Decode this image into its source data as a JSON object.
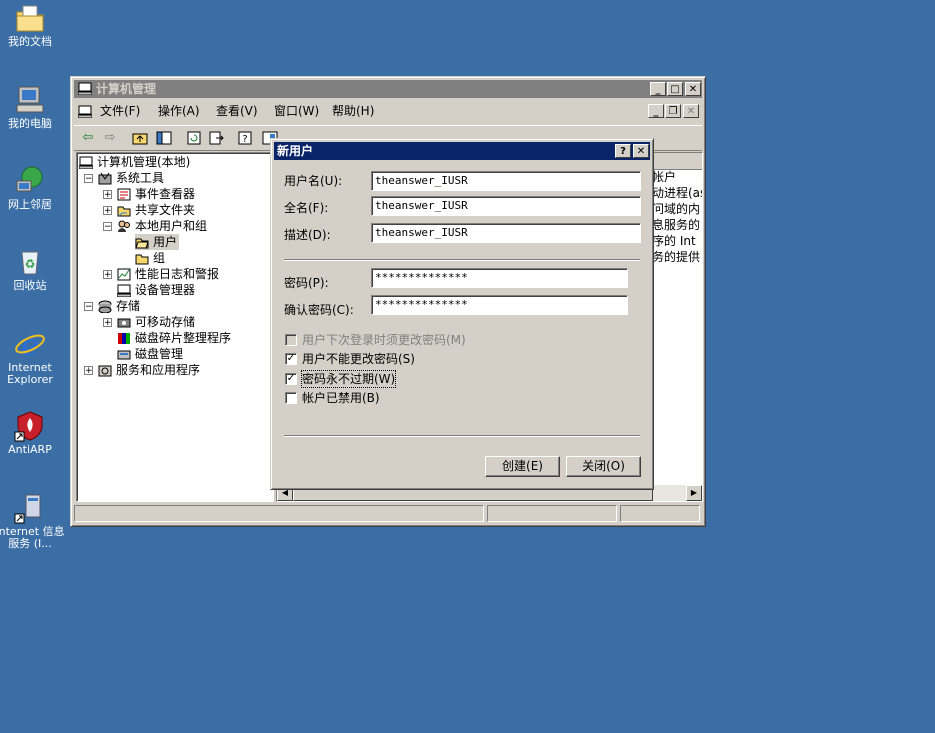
{
  "desktop": {
    "icons": [
      {
        "label": "我的文档",
        "icon": "my-documents-icon"
      },
      {
        "label": "我的电脑",
        "icon": "my-computer-icon"
      },
      {
        "label": "网上邻居",
        "icon": "network-places-icon"
      },
      {
        "label": "回收站",
        "icon": "recycle-bin-icon"
      },
      {
        "label": "Internet Explorer",
        "icon": "internet-explorer-icon"
      },
      {
        "label": "AntiARP",
        "icon": "antiarp-icon"
      },
      {
        "label": "Internet 信息服务 (I...",
        "icon": "iis-icon"
      }
    ]
  },
  "mmc": {
    "title": "计算机管理",
    "menu": [
      "文件(F)",
      "操作(A)",
      "查看(V)",
      "窗口(W)",
      "帮助(H)"
    ],
    "tree": {
      "root": "计算机管理(本地)",
      "system_tools": "系统工具",
      "event_viewer": "事件查看器",
      "shared_folders": "共享文件夹",
      "local_users_groups": "本地用户和组",
      "users": "用户",
      "groups": "组",
      "perf_logs": "性能日志和警报",
      "device_manager": "设备管理器",
      "storage": "存储",
      "removable_storage": "可移动存储",
      "defrag": "磁盘碎片整理程序",
      "disk_mgmt": "磁盘管理",
      "services_apps": "服务和应用程序"
    },
    "right_text": [
      "帐户",
      "动进程(as",
      "问域的内",
      "息服务的",
      "序的 Int",
      "务的提供"
    ]
  },
  "dialog": {
    "title": "新用户",
    "username_label": "用户名(U):",
    "username_value": "theanswer_IUSR",
    "fullname_label": "全名(F):",
    "fullname_value": "theanswer_IUSR",
    "desc_label": "描述(D):",
    "desc_value": "theanswer_IUSR",
    "password_label": "密码(P):",
    "password_value": "**************",
    "confirm_label": "确认密码(C):",
    "confirm_value": "**************",
    "opt_must_change": "用户下次登录时须更改密码(M)",
    "opt_cannot_change": "用户不能更改密码(S)",
    "opt_never_expires": "密码永不过期(W)",
    "opt_disabled": "帐户已禁用(B)",
    "check_marks": [
      "",
      "✓",
      "✓",
      ""
    ],
    "create_button": "创建(E)",
    "close_button": "关闭(O)",
    "help_glyph": "?",
    "close_glyph": "✕"
  }
}
